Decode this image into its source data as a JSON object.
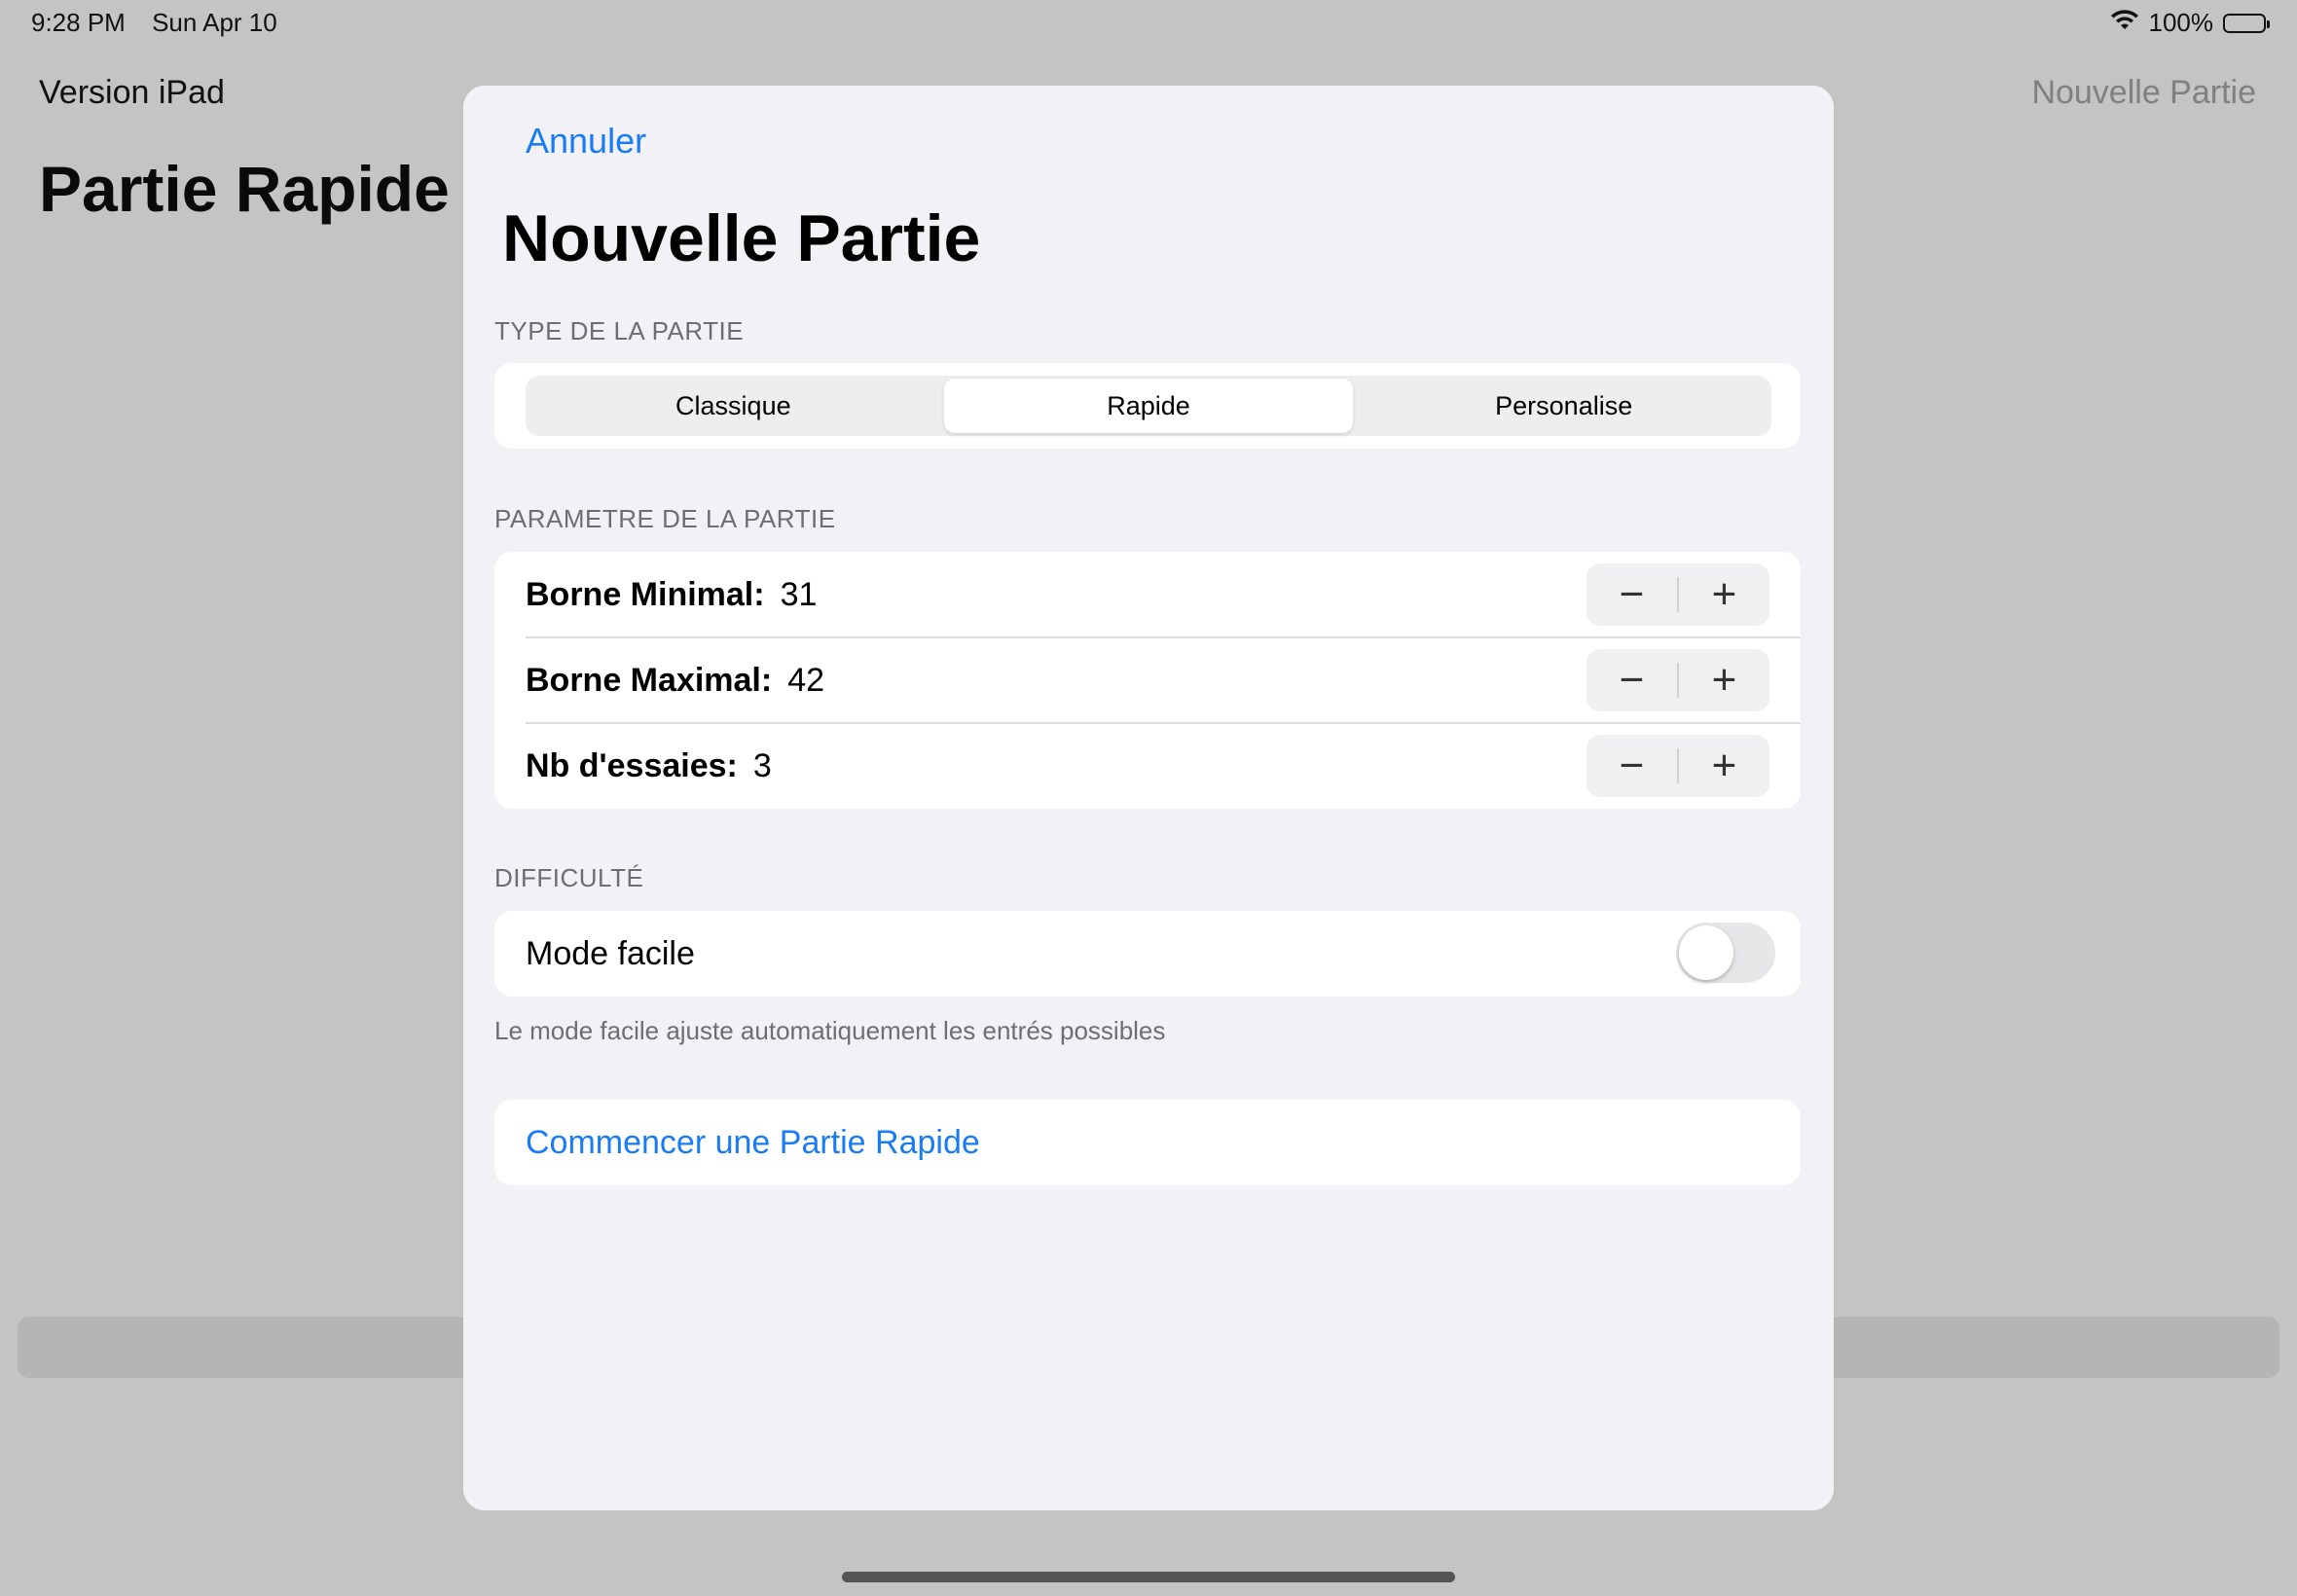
{
  "status_bar": {
    "time": "9:28 PM",
    "date": "Sun Apr 10",
    "battery": "100%",
    "wifi_icon": "wifi-icon",
    "battery_icon": "battery-icon"
  },
  "background": {
    "nav_left": "Version iPad",
    "nav_right": "Nouvelle Partie",
    "title": "Partie Rapide"
  },
  "sheet": {
    "cancel_label": "Annuler",
    "title": "Nouvelle Partie",
    "type_section": {
      "header": "TYPE DE LA PARTIE",
      "segments": [
        "Classique",
        "Rapide",
        "Personalise"
      ],
      "selected": "Rapide"
    },
    "params_section": {
      "header": "PARAMETRE DE LA PARTIE",
      "rows": [
        {
          "label": "Borne Minimal:",
          "value": "31"
        },
        {
          "label": "Borne Maximal:",
          "value": "42"
        },
        {
          "label": "Nb d'essaies:",
          "value": "3"
        }
      ],
      "minus_symbol": "−",
      "plus_symbol": "+"
    },
    "difficulty_section": {
      "header": "DIFFICULTÉ",
      "toggle_label": "Mode facile",
      "toggle_on": false,
      "footer": "Le mode facile ajuste automatiquement les entrés possibles"
    },
    "start_button": "Commencer une Partie Rapide"
  },
  "colors": {
    "accent": "#1a7cf5",
    "sheet_background": "#f2f2f6",
    "dimmed_background": "#c3c4c3"
  }
}
